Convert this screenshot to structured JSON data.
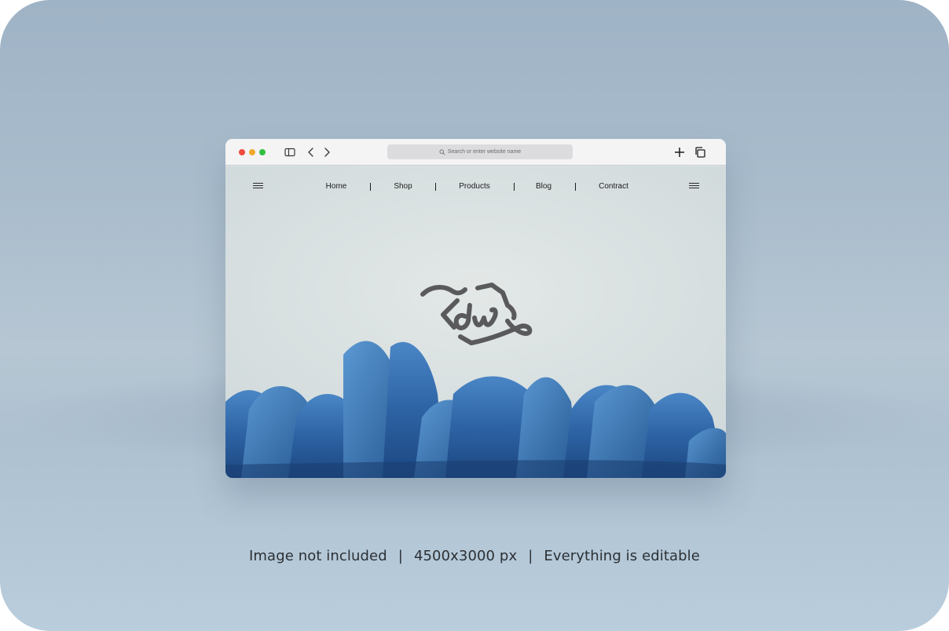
{
  "browser": {
    "address_placeholder": "Search or enter website name"
  },
  "nav": {
    "items": [
      "Home",
      "Shop",
      "Products",
      "Blog",
      "Contract"
    ]
  },
  "caption": {
    "part1": "Image not included",
    "part2": "4500x3000 px",
    "part3": "Everything is editable",
    "separator": "|"
  },
  "colors": {
    "petal_blue": "#2d63a4",
    "logo_gray": "#5a5a5c"
  }
}
